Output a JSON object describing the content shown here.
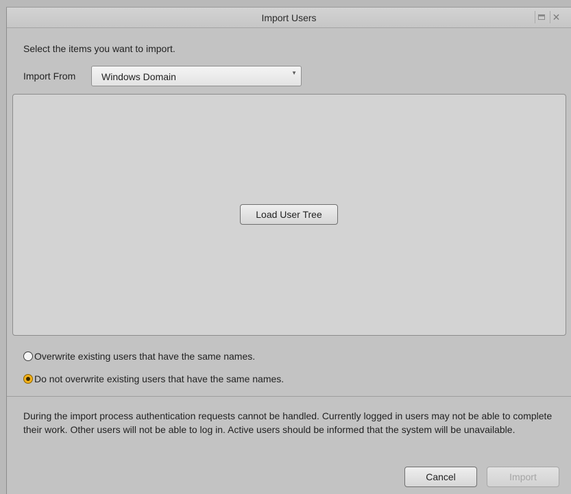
{
  "window": {
    "title": "Import Users"
  },
  "instruction": "Select the items you want to import.",
  "import_from": {
    "label": "Import From",
    "selected": "Windows Domain"
  },
  "tree_panel": {
    "load_button": "Load User Tree"
  },
  "options": [
    {
      "label": "Overwrite existing users that have the same names.",
      "checked": false
    },
    {
      "label": "Do not overwrite existing users that have the same names.",
      "checked": true
    }
  ],
  "info_text": "During the import process authentication requests cannot be handled. Currently logged in users may not be able to complete their work. Other users will not be able to log in. Active users should be informed that the system will be unavailable.",
  "footer": {
    "cancel_label": "Cancel",
    "import_label": "Import",
    "import_enabled": false
  },
  "colors": {
    "radio_selected": "#f3b21b",
    "window_bg": "#c3c3c3",
    "panel_bg": "#d3d3d3"
  },
  "icons": {
    "restore": "restore-icon",
    "close": "close-icon",
    "dropdown": "chevron-down-icon",
    "radio_off": "radio-unchecked-icon",
    "radio_on": "radio-checked-icon"
  }
}
